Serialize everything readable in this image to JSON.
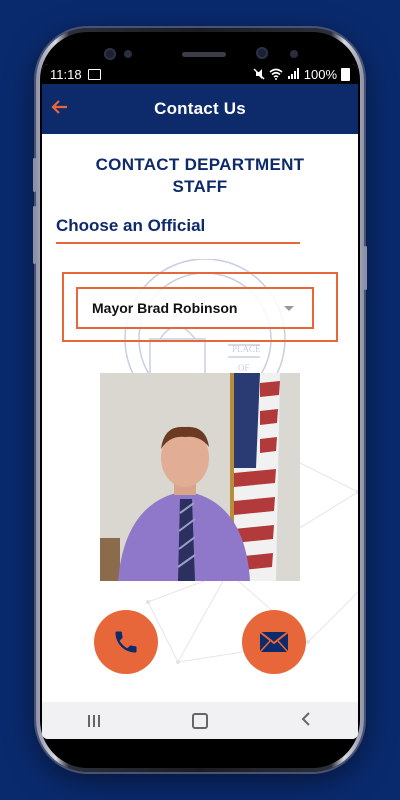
{
  "status": {
    "time": "11:18",
    "battery": "100%"
  },
  "appbar": {
    "title": "Contact Us",
    "back_icon": "arrow-left-icon"
  },
  "heading": {
    "line1": "CONTACT DEPARTMENT",
    "line2": "STAFF"
  },
  "choose": {
    "label": "Choose an Official"
  },
  "official_select": {
    "value": "Mayor Brad Robinson"
  },
  "actions": {
    "call_icon": "phone-icon",
    "email_icon": "envelope-icon"
  },
  "colors": {
    "navy": "#0d2a6b",
    "accent": "#e8673a",
    "background": "#0a2a6e"
  }
}
